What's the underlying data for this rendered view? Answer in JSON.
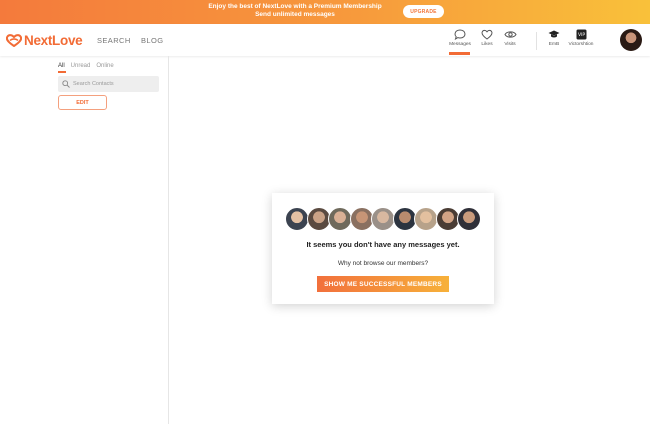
{
  "promo": {
    "line1": "Enjoy the best of NextLove with a Premium Membership",
    "line2": "Send unlimited messages",
    "upgrade_label": "UPGRADE"
  },
  "header": {
    "logo": "NextLove",
    "nav": [
      "SEARCH",
      "BLOG"
    ],
    "icons": [
      {
        "name": "messages",
        "label": "Messages",
        "icon": "chat-bubble-icon"
      },
      {
        "name": "likes",
        "label": "Likes",
        "icon": "heart-icon"
      },
      {
        "name": "visits",
        "label": "Visits",
        "icon": "eye-icon"
      },
      {
        "name": "emb",
        "label": "EmB",
        "icon": "graduation-cap-icon"
      },
      {
        "name": "victorshtion",
        "label": "Victorshtion",
        "icon": "vip-badge-icon"
      }
    ],
    "active_tab": "Messages",
    "accent": "#f26b35"
  },
  "sidebar": {
    "filters": [
      "All",
      "Unread",
      "Online"
    ],
    "active_filter": "All",
    "search_placeholder": "Search Contacts",
    "edit_label": "EDIT"
  },
  "empty_state": {
    "title": "It seems you don't have any messages yet.",
    "subtitle": "Why not browse our members?",
    "cta_label": "SHOW ME SUCCESSFUL MEMBERS",
    "member_avatar_count": 9
  }
}
